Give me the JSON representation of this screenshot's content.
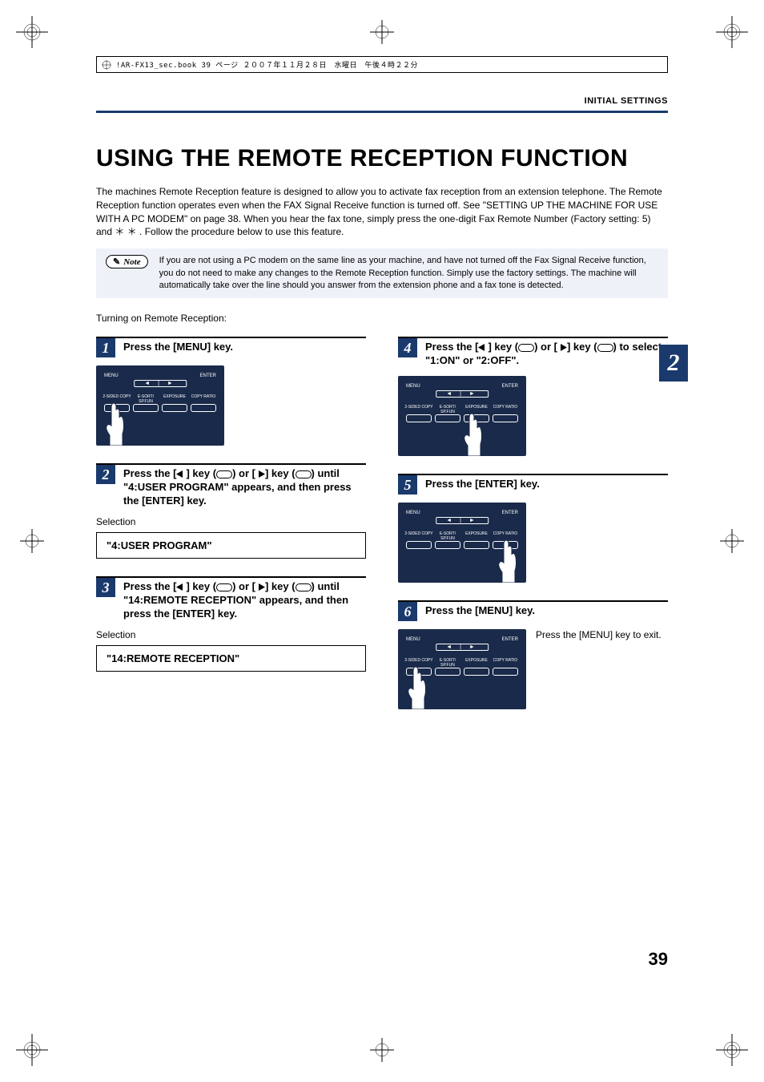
{
  "meta": {
    "source_line": "!AR-FX13_sec.book  39 ページ  ２００７年１１月２８日　水曜日　午後４時２２分"
  },
  "header": {
    "section": "INITIAL SETTINGS"
  },
  "title": "USING THE REMOTE RECEPTION FUNCTION",
  "intro": "The machines Remote Reception feature is designed to allow you to activate fax reception from an extension telephone. The Remote Reception function operates even when the FAX Signal Receive function is turned off. See \"SETTING UP THE MACHINE FOR USE WITH A PC MODEM\" on page 38. When you hear the fax tone, simply press the one-digit Fax Remote Number (Factory setting: 5) and  ＊ ＊ . Follow the procedure below to use this feature.",
  "note": {
    "label": "Note",
    "text": "If you are not using a PC modem on the same line as your machine, and have not turned off the Fax Signal Receive function, you do not need to make any changes to the Remote Reception function. Simply use the factory settings. The machine will automatically take over the line should you answer from the extension phone and a fax tone is detected."
  },
  "section_label": "Turning on Remote Reception:",
  "panel": {
    "menu": "MENU",
    "enter": "ENTER",
    "arrows_line": "◄ | ►",
    "arrows_line2": "∨ | ∧",
    "sub1": "2-SIDED COPY",
    "sub2": "E-SORT/ SP.FUN",
    "sub3": "EXPOSURE",
    "sub4": "COPY RATIO"
  },
  "steps": [
    {
      "num": "1",
      "title_plain": "Press the [MENU] key.",
      "has_panel": true,
      "hand_pos": "left"
    },
    {
      "num": "2",
      "title_prefix": "Press the [",
      "title_mid1": "] key (",
      "title_mid2": ") or [",
      "title_mid3": "] key (",
      "title_suffix": ") until \"4:USER PROGRAM\" appears, and then press the [ENTER] key.",
      "has_arrows": true,
      "selection_label": "Selection",
      "display": "\"4:USER PROGRAM\""
    },
    {
      "num": "3",
      "title_prefix": "Press the [",
      "title_mid1": "] key (",
      "title_mid2": ") or [",
      "title_mid3": "] key (",
      "title_suffix": ") until \"14:REMOTE RECEPTION\" appears, and then press the [ENTER] key.",
      "has_arrows": true,
      "selection_label": "Selection",
      "display": "\"14:REMOTE RECEPTION\""
    },
    {
      "num": "4",
      "title_prefix": "Press the [",
      "title_mid1": "] key (",
      "title_mid2": ") or [",
      "title_mid3": "] key (",
      "title_suffix": ") to select \"1:ON\" or \"2:OFF\".",
      "has_arrows": true,
      "has_panel": true,
      "hand_pos": "mid"
    },
    {
      "num": "5",
      "title_plain": "Press the [ENTER] key.",
      "has_panel": true,
      "hand_pos": "right"
    },
    {
      "num": "6",
      "title_plain": "Press the [MENU] key.",
      "has_panel": true,
      "hand_pos": "left",
      "aux_text": "Press the [MENU] key to exit."
    }
  ],
  "side_tab": "2",
  "page_number": "39"
}
